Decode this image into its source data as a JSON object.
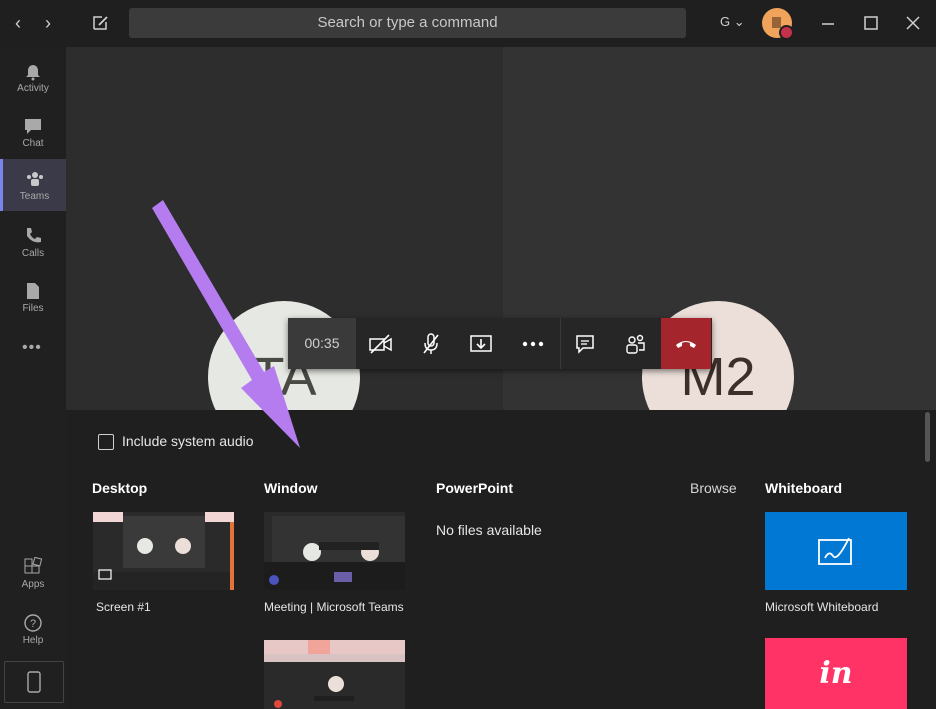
{
  "topbar": {
    "search_placeholder": "Search or type a command",
    "org_initial": "G",
    "org_chevron": "⌄"
  },
  "rail": {
    "items": [
      {
        "label": "Activity",
        "icon": "bell-icon"
      },
      {
        "label": "Chat",
        "icon": "chat-icon"
      },
      {
        "label": "Teams",
        "icon": "teams-icon"
      },
      {
        "label": "Calls",
        "icon": "phone-icon"
      },
      {
        "label": "Files",
        "icon": "file-icon"
      },
      {
        "label": "Apps",
        "icon": "apps-icon"
      },
      {
        "label": "Help",
        "icon": "help-icon"
      }
    ],
    "more": "•••"
  },
  "call": {
    "participants": [
      "TA",
      "M2"
    ],
    "timer": "00:35"
  },
  "share_tray": {
    "include_audio_label": "Include system audio",
    "include_audio_checked": false,
    "desktop": {
      "heading": "Desktop",
      "items": [
        "Screen #1"
      ]
    },
    "window": {
      "heading": "Window",
      "items": [
        "Meeting | Microsoft Teams",
        ""
      ]
    },
    "powerpoint": {
      "heading": "PowerPoint",
      "browse": "Browse",
      "empty": "No files available"
    },
    "whiteboard": {
      "heading": "Whiteboard",
      "items": [
        "Microsoft Whiteboard",
        ""
      ],
      "logo_text": "in"
    }
  },
  "colors": {
    "accent": "#7b83eb",
    "hangup": "#a4262c",
    "whiteboard": "#0078d4",
    "invision": "#ff3366",
    "annotation_arrow": "#b57cf0"
  }
}
